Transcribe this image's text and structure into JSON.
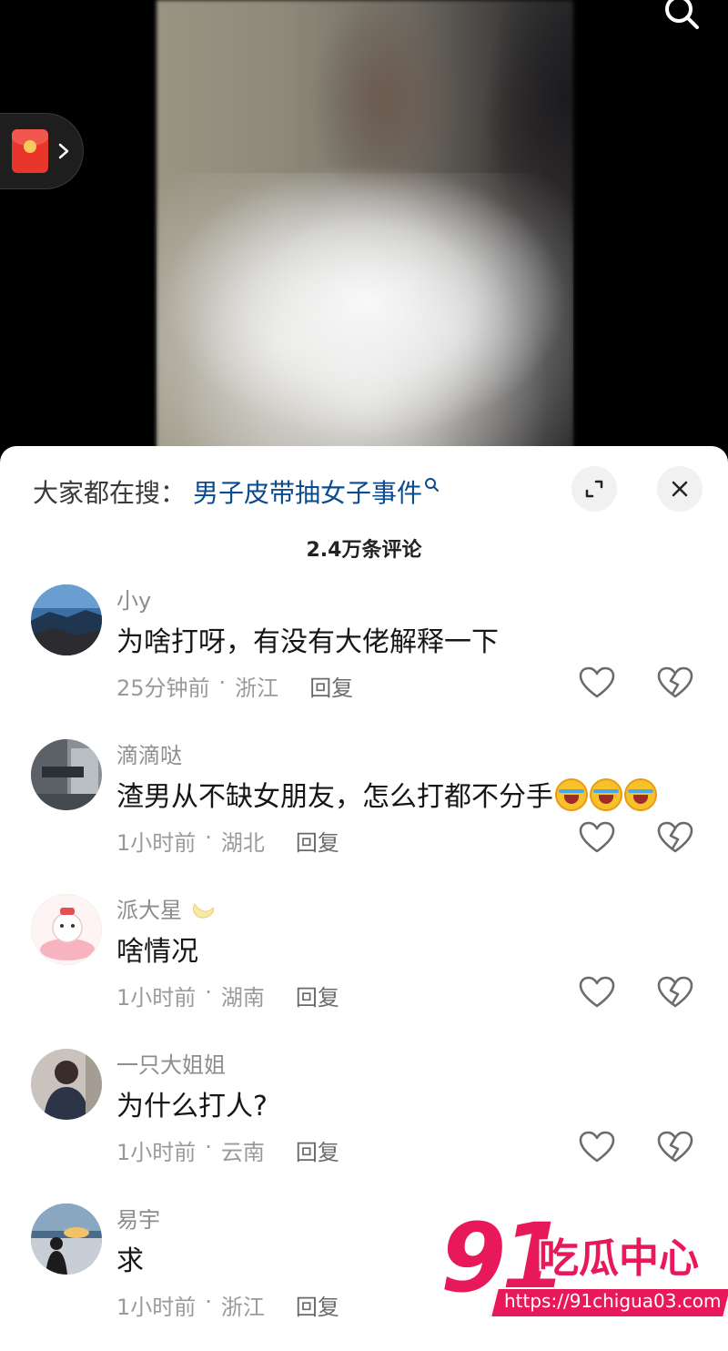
{
  "hot_search": {
    "label": "大家都在搜：",
    "term": "男子皮带抽女子事件"
  },
  "comments_header": {
    "count_label": "2.4万条评论"
  },
  "comments": [
    {
      "username": "小y",
      "text": "为啥打呀，有没有大佬解释一下",
      "time": "25分钟前",
      "location": "浙江",
      "reply_label": "回复"
    },
    {
      "username": "滴滴哒",
      "text": "渣男从不缺女朋友，怎么打都不分手",
      "emojis": [
        "laugh-cry-emoji",
        "laugh-cry-emoji",
        "laugh-cry-emoji"
      ],
      "time": "1小时前",
      "location": "湖北",
      "reply_label": "回复"
    },
    {
      "username": "派大星",
      "text": "啥情况",
      "time": "1小时前",
      "location": "湖南",
      "reply_label": "回复"
    },
    {
      "username": "一只大姐姐",
      "text": "为什么打人?",
      "time": "1小时前",
      "location": "云南",
      "reply_label": "回复"
    },
    {
      "username": "易宇",
      "text": "求",
      "time": "1小时前",
      "location": "浙江",
      "reply_label": "回复"
    }
  ],
  "separator": "·",
  "watermark": {
    "number": "91",
    "name": "吃瓜中心",
    "url": "https://91chigua03.com"
  },
  "colors": {
    "search_term": "#0b4a8f",
    "watermark": "#e8195a",
    "red_packet": "#e8362c"
  }
}
